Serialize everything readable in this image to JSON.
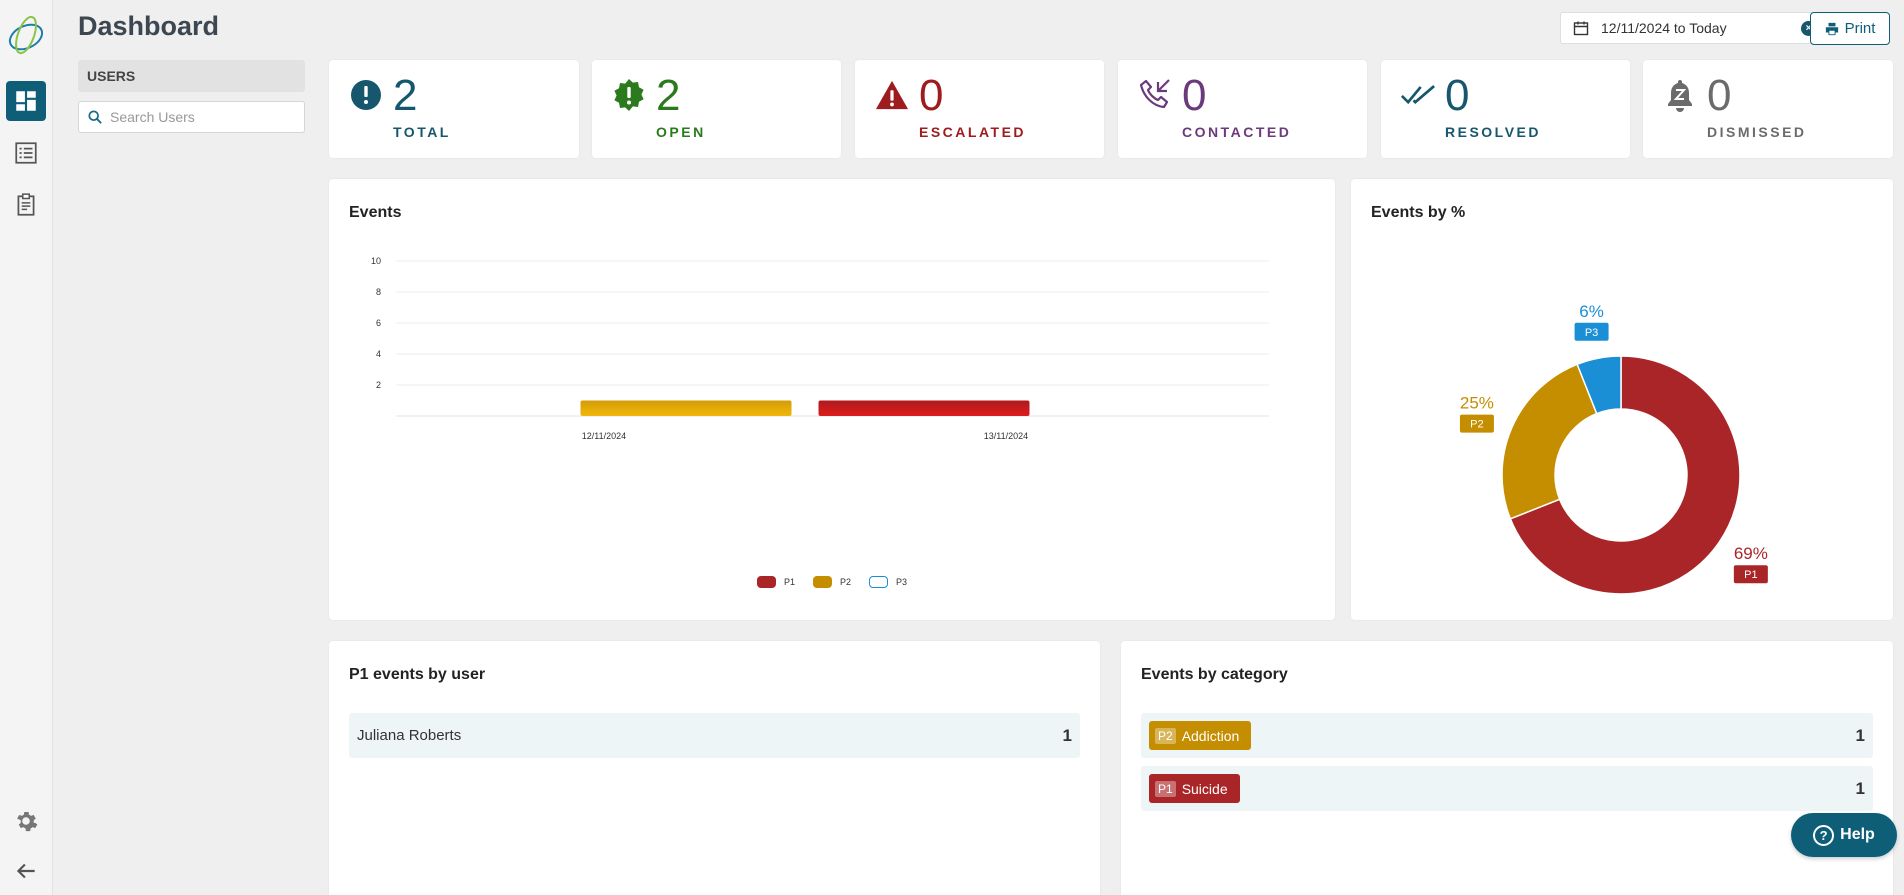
{
  "colors": {
    "brand": "#0e5e78",
    "p1": "#a92527",
    "p2": "#c58e00",
    "p3": "#1a8fd6"
  },
  "header": {
    "title": "Dashboard",
    "date_range": "12/11/2024 to Today",
    "print_label": "Print"
  },
  "users": {
    "heading": "USERS",
    "search_placeholder": "Search Users"
  },
  "stats": [
    {
      "value": "2",
      "label": "TOTAL",
      "color": "#16576d",
      "icon": "alert-circle-icon"
    },
    {
      "value": "2",
      "label": "OPEN",
      "color": "#2b7a1d",
      "icon": "alert-badge-icon"
    },
    {
      "value": "0",
      "label": "ESCALATED",
      "color": "#9e1b1e",
      "icon": "warning-triangle-icon"
    },
    {
      "value": "0",
      "label": "CONTACTED",
      "color": "#6b3a7d",
      "icon": "phone-callback-icon"
    },
    {
      "value": "0",
      "label": "RESOLVED",
      "color": "#16576d",
      "icon": "double-check-icon"
    },
    {
      "value": "0",
      "label": "DISMISSED",
      "color": "#6b6b6b",
      "icon": "bell-snooze-icon"
    }
  ],
  "events_card": {
    "title": "Events"
  },
  "pct_card": {
    "title": "Events by %"
  },
  "p1_card": {
    "title": "P1 events by user",
    "rows": [
      {
        "name": "Juliana Roberts",
        "count": "1"
      }
    ]
  },
  "cat_card": {
    "title": "Events by category",
    "rows": [
      {
        "priority": "P2",
        "category": "Addiction",
        "count": "1"
      },
      {
        "priority": "P1",
        "category": "Suicide",
        "count": "1"
      }
    ]
  },
  "help_label": "Help",
  "chart_data": [
    {
      "type": "bar",
      "title": "Events",
      "categories": [
        "12/11/2024",
        "13/11/2024"
      ],
      "series": [
        {
          "name": "P1",
          "values": [
            0,
            1
          ]
        },
        {
          "name": "P2",
          "values": [
            1,
            0
          ]
        },
        {
          "name": "P3",
          "values": [
            0,
            0
          ]
        }
      ],
      "yticks": [
        2,
        4,
        6,
        8,
        10
      ],
      "ylim": [
        0,
        10
      ],
      "legend": "bottom",
      "grid": true
    },
    {
      "type": "pie",
      "title": "Events by %",
      "slices": [
        {
          "name": "P1",
          "value": 69,
          "label": "69%"
        },
        {
          "name": "P2",
          "value": 25,
          "label": "25%"
        },
        {
          "name": "P3",
          "value": 6,
          "label": "6%"
        }
      ]
    }
  ]
}
